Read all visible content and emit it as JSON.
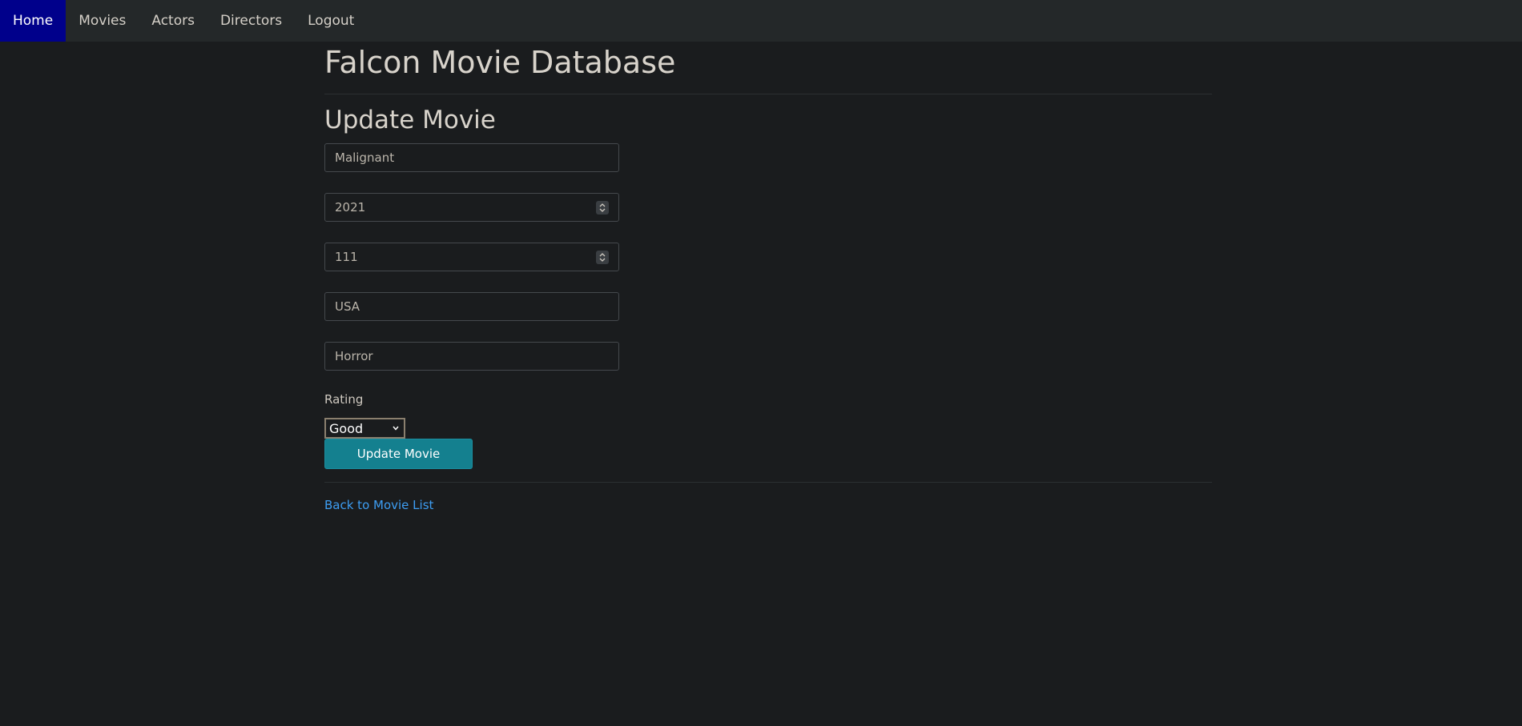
{
  "nav": {
    "items": [
      {
        "label": "Home",
        "active": true
      },
      {
        "label": "Movies"
      },
      {
        "label": "Actors"
      },
      {
        "label": "Directors"
      },
      {
        "label": "Logout"
      }
    ]
  },
  "page": {
    "title": "Falcon Movie Database",
    "form_title": "Update Movie"
  },
  "form": {
    "title_value": "Malignant",
    "year_value": "2021",
    "runtime_value": "111",
    "country_value": "USA",
    "genre_value": "Horror",
    "rating_label": "Rating",
    "rating_selected": "Good",
    "submit_label": "Update Movie"
  },
  "links": {
    "back": "Back to Movie List"
  },
  "colors": {
    "background": "#1a1c1e",
    "navbar": "#242829",
    "nav_active": "#00008b",
    "button": "#14808f",
    "link": "#3d9df2"
  }
}
